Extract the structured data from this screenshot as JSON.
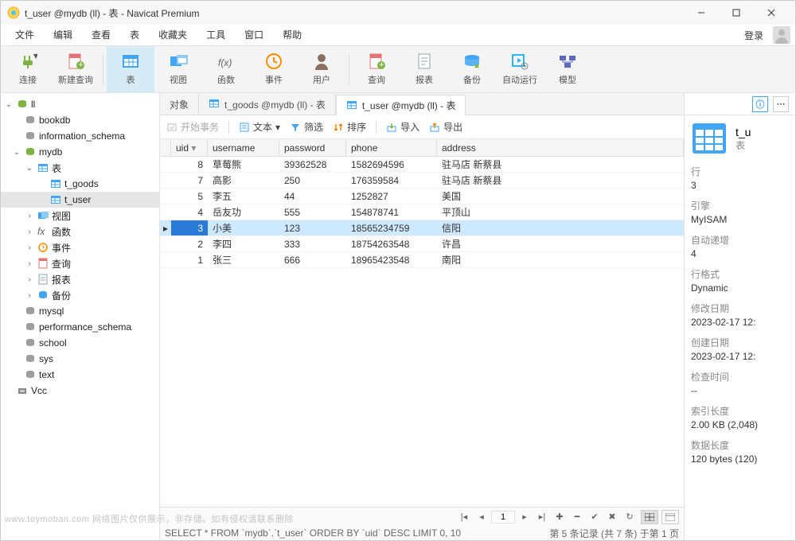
{
  "window": {
    "title": "t_user @mydb (ll) - 表 - Navicat Premium"
  },
  "menu": {
    "items": [
      "文件",
      "编辑",
      "查看",
      "表",
      "收藏夹",
      "工具",
      "窗口",
      "帮助"
    ],
    "login": "登录"
  },
  "toolbar": {
    "items": [
      {
        "label": "连接",
        "icon": "plug",
        "color": "#7cb342"
      },
      {
        "label": "新建查询",
        "icon": "sheet",
        "color": "#e57373"
      },
      {
        "label": "表",
        "icon": "table",
        "color": "#42a5f5",
        "active": true
      },
      {
        "label": "视图",
        "icon": "view",
        "color": "#42a5f5"
      },
      {
        "label": "函数",
        "icon": "fx",
        "color": "#616161"
      },
      {
        "label": "事件",
        "icon": "clock",
        "color": "#fb8c00"
      },
      {
        "label": "用户",
        "icon": "user",
        "color": "#8d6e63"
      },
      {
        "label": "查询",
        "icon": "sheet",
        "color": "#e57373"
      },
      {
        "label": "报表",
        "icon": "report",
        "color": "#90a4ae"
      },
      {
        "label": "备份",
        "icon": "backup",
        "color": "#42a5f5"
      },
      {
        "label": "自动运行",
        "icon": "auto",
        "color": "#29b6f6"
      },
      {
        "label": "模型",
        "icon": "model",
        "color": "#5c6bc0"
      }
    ]
  },
  "sidebar": {
    "root": "ll",
    "nodes": [
      {
        "l": "ll",
        "d": 0,
        "icon": "db-green",
        "expand": "open"
      },
      {
        "l": "bookdb",
        "d": 1,
        "icon": "db-grey"
      },
      {
        "l": "information_schema",
        "d": 1,
        "icon": "db-grey"
      },
      {
        "l": "mydb",
        "d": 1,
        "icon": "db-green",
        "expand": "open"
      },
      {
        "l": "表",
        "d": 2,
        "icon": "table-blue",
        "expand": "open"
      },
      {
        "l": "t_goods",
        "d": 3,
        "icon": "table-blue"
      },
      {
        "l": "t_user",
        "d": 3,
        "icon": "table-blue",
        "selected": true
      },
      {
        "l": "视图",
        "d": 2,
        "icon": "view-blue",
        "caret": ">"
      },
      {
        "l": "函数",
        "d": 2,
        "icon": "fx",
        "caret": ">"
      },
      {
        "l": "事件",
        "d": 2,
        "icon": "clock",
        "caret": ">"
      },
      {
        "l": "查询",
        "d": 2,
        "icon": "sheet",
        "caret": ">"
      },
      {
        "l": "报表",
        "d": 2,
        "icon": "report",
        "caret": ">"
      },
      {
        "l": "备份",
        "d": 2,
        "icon": "backup",
        "caret": ">"
      },
      {
        "l": "mysql",
        "d": 1,
        "icon": "db-grey"
      },
      {
        "l": "performance_schema",
        "d": 1,
        "icon": "db-grey"
      },
      {
        "l": "school",
        "d": 1,
        "icon": "db-grey"
      },
      {
        "l": "sys",
        "d": 1,
        "icon": "db-grey"
      },
      {
        "l": "text",
        "d": 1,
        "icon": "db-grey"
      },
      {
        "l": "Vcc",
        "d": 0,
        "icon": "conn"
      }
    ]
  },
  "tabs": [
    {
      "label": "对象",
      "active": false,
      "icon": null
    },
    {
      "label": "t_goods @mydb (ll) - 表",
      "active": false,
      "icon": "table"
    },
    {
      "label": "t_user @mydb (ll) - 表",
      "active": true,
      "icon": "table"
    }
  ],
  "actionbar": {
    "begin": "开始事务",
    "text": "文本",
    "drop": "▾",
    "filter": "筛选",
    "sort": "排序",
    "import": "导入",
    "export": "导出"
  },
  "grid": {
    "columns": [
      "uid",
      "username",
      "password",
      "phone",
      "address"
    ],
    "sort_col": "uid",
    "sort_dir": "desc",
    "rows": [
      {
        "uid": 8,
        "username": "草莓熊",
        "password": "39362528",
        "phone": "1582694596",
        "address": "驻马店 新蔡县"
      },
      {
        "uid": 7,
        "username": "高影",
        "password": "250",
        "phone": "176359584",
        "address": "驻马店 新蔡县"
      },
      {
        "uid": 5,
        "username": "李五",
        "password": "44",
        "phone": "1252827",
        "address": "美国"
      },
      {
        "uid": 4,
        "username": "岳友功",
        "password": "555",
        "phone": "154878741",
        "address": "平顶山"
      },
      {
        "uid": 3,
        "username": "小美",
        "password": "123",
        "phone": "18565234759",
        "address": "信阳",
        "selected": true
      },
      {
        "uid": 2,
        "username": "李四",
        "password": "333",
        "phone": "18754263548",
        "address": "许昌"
      },
      {
        "uid": 1,
        "username": "张三",
        "password": "666",
        "phone": "18965423548",
        "address": "南阳"
      }
    ]
  },
  "pager": {
    "page": "1"
  },
  "footer": {
    "sql": "SELECT * FROM `mydb`.`t_user` ORDER BY `uid` DESC LIMIT 0, 10",
    "pos": "第 5 条记录 (共 7 条) 于第 1 页"
  },
  "info": {
    "obj_name": "t_u",
    "obj_type": "表",
    "props": [
      {
        "k": "行",
        "v": "3"
      },
      {
        "k": "引擎",
        "v": "MyISAM"
      },
      {
        "k": "自动递增",
        "v": "4"
      },
      {
        "k": "行格式",
        "v": "Dynamic"
      },
      {
        "k": "修改日期",
        "v": "2023-02-17 12:"
      },
      {
        "k": "创建日期",
        "v": "2023-02-17 12:"
      },
      {
        "k": "检查时间",
        "v": "--"
      },
      {
        "k": "索引长度",
        "v": "2.00 KB (2,048)"
      },
      {
        "k": "数据长度",
        "v": "120 bytes (120)"
      }
    ]
  },
  "watermark": "www.toymoban.com  网络图片仅供展示，非存储。如有侵权请联系删除"
}
